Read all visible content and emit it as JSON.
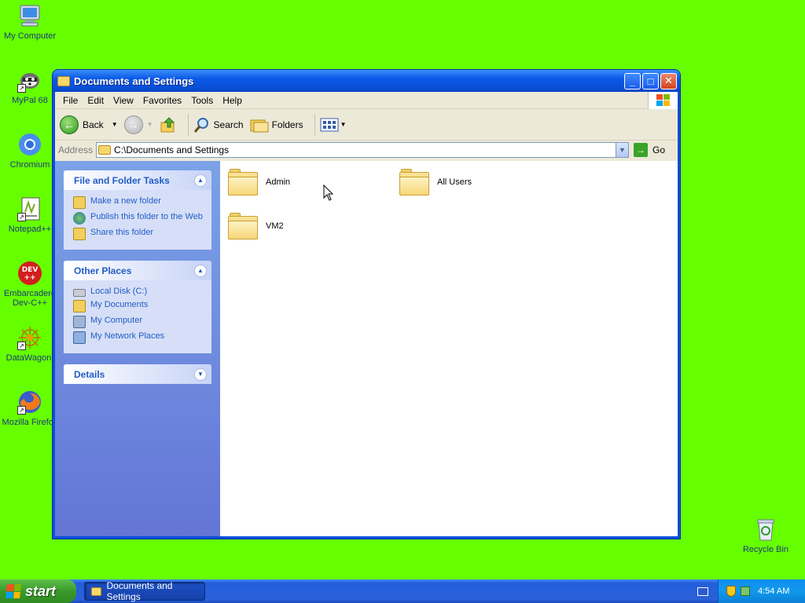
{
  "desktop": {
    "icons": [
      {
        "label": "My Computer"
      },
      {
        "label": "MyPal 68"
      },
      {
        "label": "Chromium"
      },
      {
        "label": "Notepad++"
      },
      {
        "label": "Embarcadero Dev-C++",
        "line1": "Embarcadero",
        "line2": "Dev-C++",
        "badge": "DEV\n++"
      },
      {
        "label": "DataWagon."
      },
      {
        "label": "Mozilla Firefox"
      },
      {
        "label": "Recycle Bin"
      }
    ]
  },
  "window": {
    "title": "Documents and Settings",
    "minimize": "_",
    "maximize": "□",
    "close": "✕"
  },
  "menu": [
    "File",
    "Edit",
    "View",
    "Favorites",
    "Tools",
    "Help"
  ],
  "toolbar": {
    "back": "Back",
    "search": "Search",
    "folders": "Folders"
  },
  "address": {
    "label": "Address",
    "value": "C:\\Documents and Settings",
    "go": "Go"
  },
  "taskpane": {
    "file_tasks": {
      "title": "File and Folder Tasks",
      "links": [
        "Make a new folder",
        "Publish this folder to the Web",
        "Share this folder"
      ]
    },
    "other_places": {
      "title": "Other Places",
      "links": [
        "Local Disk (C:)",
        "My Documents",
        "My Computer",
        "My Network Places"
      ]
    },
    "details": {
      "title": "Details"
    }
  },
  "folders": [
    "Admin",
    "All Users",
    "VM2"
  ],
  "taskbar": {
    "start": "start",
    "task": "Documents and Settings",
    "clock": "4:54 AM"
  },
  "colors": {
    "desktop": "#66ff00",
    "titlebar": "#0a59e8",
    "taskpane": "#7ba2e7",
    "link": "#215dc6"
  }
}
